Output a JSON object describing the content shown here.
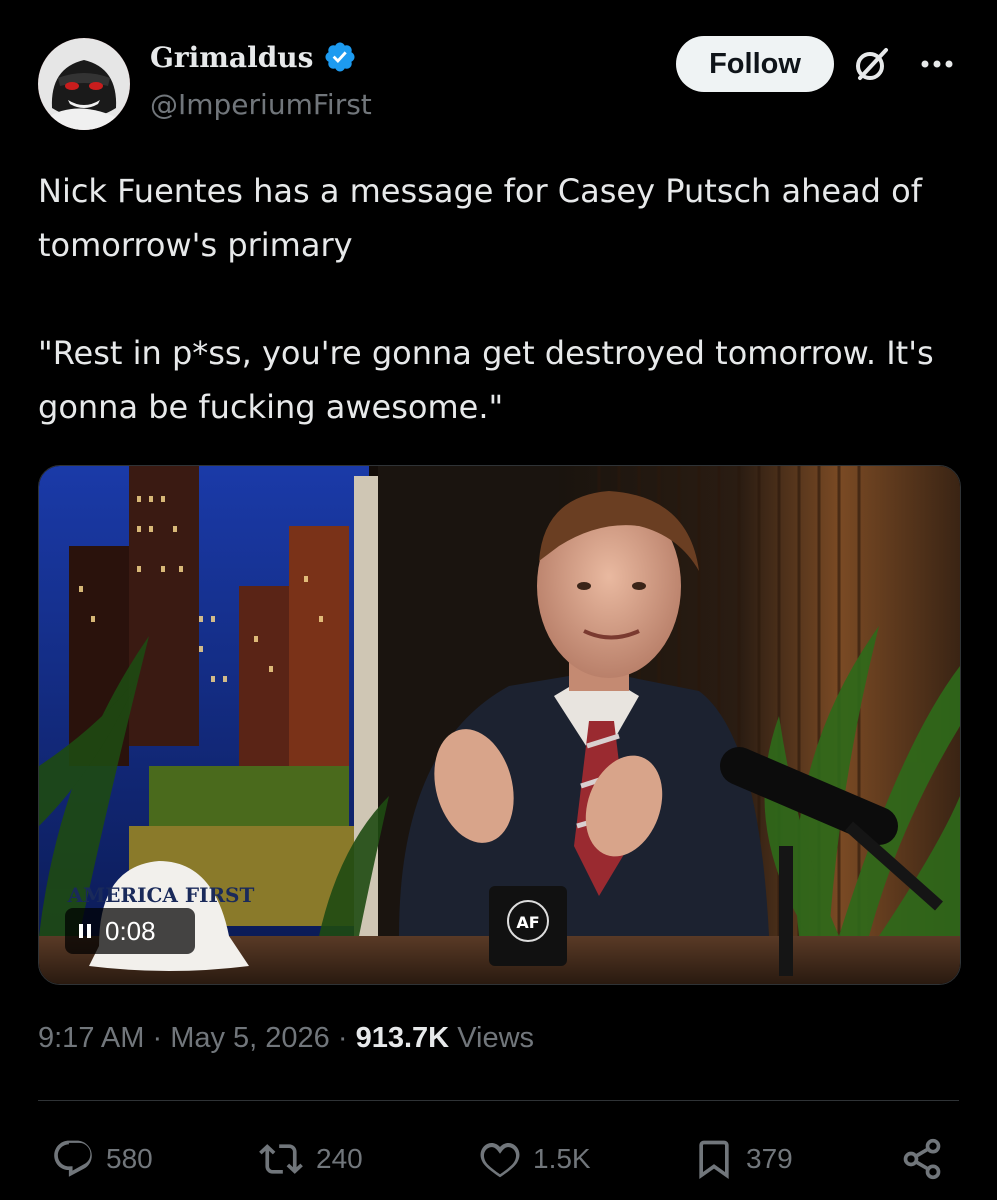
{
  "author": {
    "name": "Grimaldus",
    "handle": "@ImperiumFirst",
    "verified": true,
    "avatar_icon": "masked-face-avatar"
  },
  "header": {
    "follow_label": "Follow",
    "grok_icon": "grok-icon",
    "more_icon": "more-icon"
  },
  "tweet": {
    "paragraphs": [
      "Nick Fuentes has a message for Casey Putsch ahead of tomorrow's primary",
      "\"Rest in p*ss, you're gonna get destroyed tomorrow. It's gonna be fucking awesome.\""
    ]
  },
  "media": {
    "type": "video",
    "timer": "0:08",
    "hat_text": "AMERICA FIRST",
    "mug_text": "AF"
  },
  "meta": {
    "time": "9:17 AM",
    "separator": "·",
    "date": "May 5, 2026",
    "views_count": "913.7K",
    "views_label": "Views"
  },
  "actions": {
    "replies": "580",
    "reposts": "240",
    "likes": "1.5K",
    "bookmarks": "379"
  },
  "colors": {
    "background": "#000000",
    "text": "#e7e9ea",
    "muted": "#71767b",
    "verified": "#1d9bf0",
    "divider": "#2f3336"
  }
}
